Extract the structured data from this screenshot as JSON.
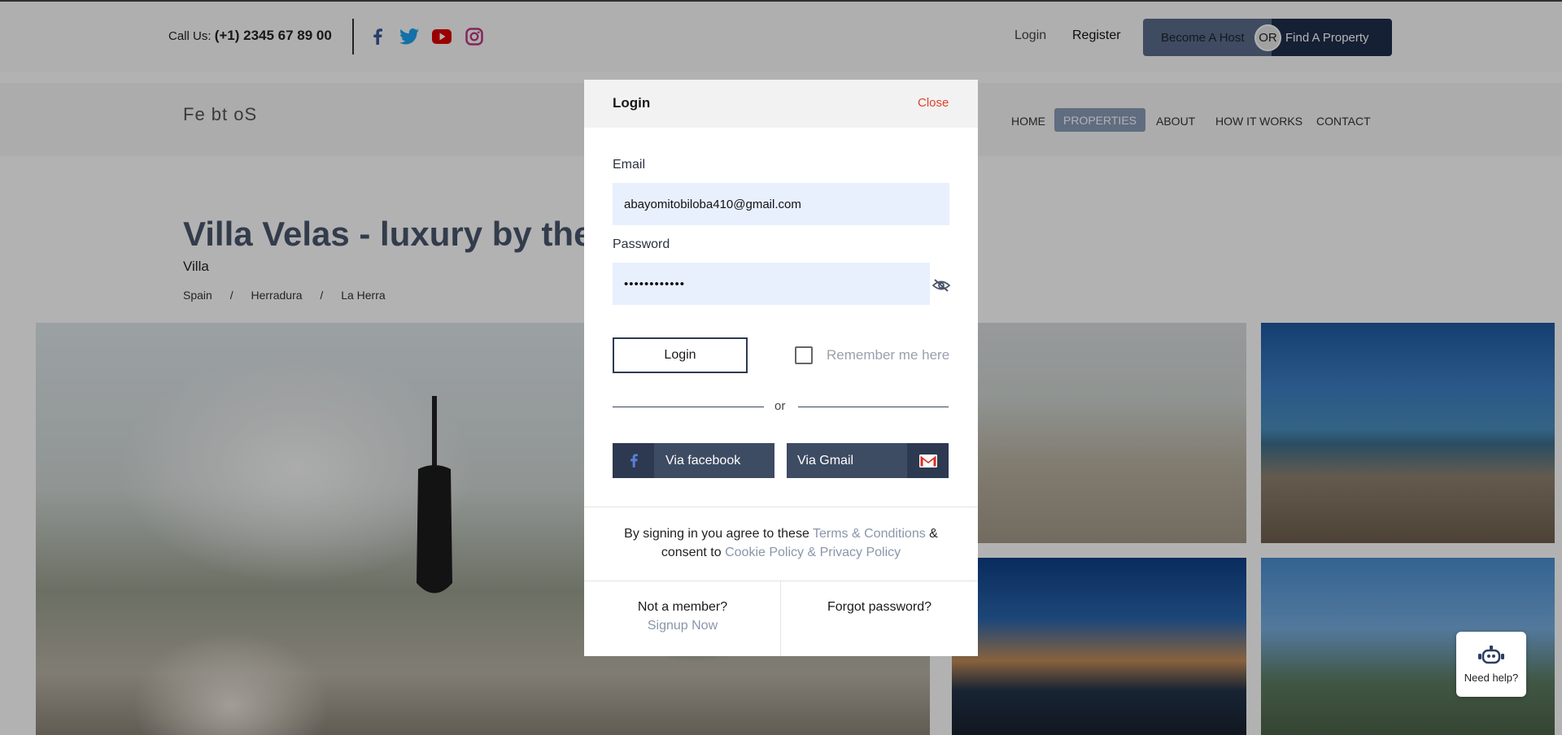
{
  "topbar": {
    "call_label": "Call Us:",
    "phone": "(+1) 2345 67 89 00",
    "social_icons": [
      "facebook-icon",
      "twitter-icon",
      "youtube-icon",
      "instagram-icon"
    ],
    "login": "Login",
    "register": "Register",
    "become_host": "Become A Host",
    "or": "OR",
    "find_property": "Find A Property"
  },
  "navbar": {
    "logo": "Fe bt oS",
    "items": [
      "HOME",
      "PROPERTIES",
      "ABOUT",
      "HOW IT WORKS",
      "CONTACT"
    ],
    "active": "PROPERTIES"
  },
  "listing": {
    "title": "Villa Velas - luxury by the s",
    "type": "Villa",
    "breadcrumbs": [
      "Spain",
      "/",
      "Herradura",
      "/",
      "La Herra"
    ]
  },
  "help_widget": {
    "label": "Need help?"
  },
  "modal": {
    "title": "Login",
    "close": "Close",
    "email_label": "Email",
    "email_value": "abayomitobiloba410@gmail.com",
    "password_label": "Password",
    "password_value": "••••••••••••",
    "login_button": "Login",
    "remember": "Remember me here",
    "or": "or",
    "via_facebook": "Via facebook",
    "via_gmail": "Via Gmail",
    "agree_prefix": "By signing in you agree to these",
    "terms": "Terms & Conditions",
    "amp": "&",
    "consent": "consent to",
    "cookie": "Cookie Policy & Privacy Policy",
    "not_member": "Not a member?",
    "signup": "Signup Now",
    "forgot": "Forgot password?"
  },
  "colors": {
    "accent_dark": "#2d3a52",
    "close_red": "#e0422c",
    "link_muted": "#8996aa",
    "input_bg": "#e8f0fe"
  }
}
